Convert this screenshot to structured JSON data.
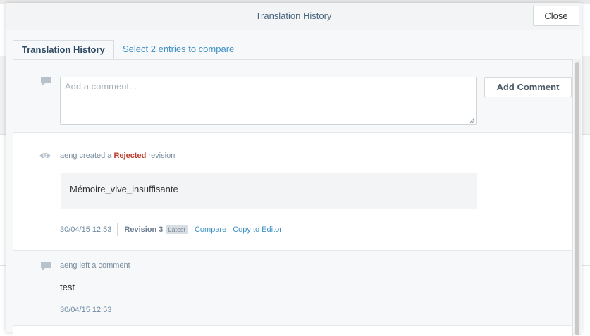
{
  "modal": {
    "title": "Translation History",
    "close_label": "Close"
  },
  "tabs": [
    {
      "label": "Translation History",
      "active": true
    },
    {
      "label": "Select 2 entries to compare",
      "active": false
    }
  ],
  "comment_form": {
    "placeholder": "Add a comment...",
    "value": "",
    "submit_label": "Add Comment"
  },
  "revision_entry": {
    "user": "aeng",
    "action_prefix": "created a",
    "status": "Rejected",
    "action_suffix": "revision",
    "text": "Mémoire_vive_insuffisante",
    "date": "30/04/15 12:53",
    "revision_label": "Revision 3",
    "badge": "Latest",
    "compare_label": "Compare",
    "copy_label": "Copy to Editor"
  },
  "comment_entry": {
    "user": "aeng",
    "action": "left a comment",
    "text": "test",
    "date": "30/04/15 12:53"
  },
  "colors": {
    "accent": "#3f91c7",
    "rejected": "#c0392b",
    "title": "#4a6680"
  }
}
